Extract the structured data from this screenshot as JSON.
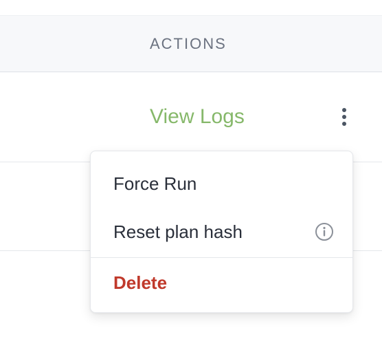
{
  "table": {
    "header": {
      "actions_label": "ACTIONS"
    },
    "rows": [
      {
        "view_logs_label": "View Logs",
        "more_icon": "kebab-vertical-icon"
      },
      {}
    ]
  },
  "context_menu": {
    "items": [
      {
        "label": "Force Run"
      },
      {
        "label": "Reset plan hash",
        "icon": "info-circle-icon"
      },
      {
        "label": "Delete",
        "color": "#c0392b"
      }
    ]
  },
  "colors": {
    "view_logs": "#86b86a",
    "delete": "#c0392b",
    "header_bg": "#f7f8fa"
  }
}
